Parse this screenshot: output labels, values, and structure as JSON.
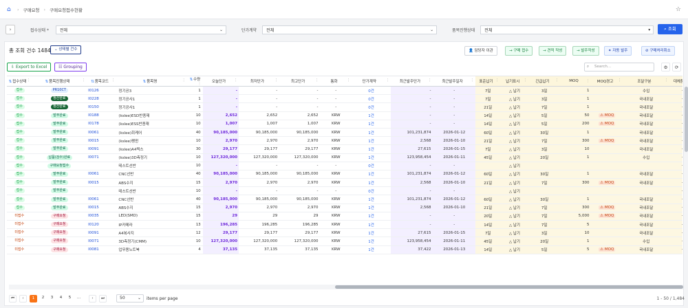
{
  "breadcrumb": [
    "구매요청",
    "구매요청접수현황"
  ],
  "filters": {
    "status_label": "접수상태 *",
    "status_value": "전체",
    "contract_label": "단가계약",
    "contract_value": "전체",
    "progress_label": "품목진행상태",
    "progress_value": "전체",
    "search_label": "조회"
  },
  "summary": {
    "text": "총 조회 건수  1484 건",
    "detail_btn": "상태별 건수"
  },
  "toolbar": {
    "transfer": "담당자 이관",
    "receive": "구매 접수",
    "estimate": "견적 작성",
    "order": "발주작성",
    "auto_order": "자동 발주",
    "cancel": "구매처리취소"
  },
  "actions": {
    "export": "Export to Excel",
    "grouping": "Grouping",
    "search_placeholder": "Search..."
  },
  "columns": [
    "접수상태",
    "품목진행상태",
    "품목코드",
    "품목명",
    "수량",
    "오늘단가",
    "최저단가",
    "최고단가",
    "통화",
    "단가계약",
    "최근발주단가",
    "최근발주일자",
    "표준납기",
    "납기표시",
    "긴급납기",
    "MOQ",
    "MOQ경고",
    "조달구분",
    "대체품목"
  ],
  "rows": [
    [
      "접수",
      "PR10CT",
      "I0126",
      "정기공3",
      "1",
      "-",
      "-",
      "-",
      "-",
      "0건",
      "-",
      "-",
      "7일",
      "△ 납기",
      "3일",
      "1",
      "",
      "수입",
      "-"
    ],
    [
      "접수",
      "정산완료",
      "I0228",
      "정기공사1",
      "1",
      "-",
      "-",
      "-",
      "-",
      "0건",
      "-",
      "-",
      "7일",
      "△ 납기",
      "3일",
      "1",
      "",
      "국내조달",
      "-"
    ],
    [
      "접수",
      "정산완료",
      "I0150",
      "정기공사1",
      "1",
      "-",
      "-",
      "-",
      "-",
      "0건",
      "-",
      "-",
      "21일",
      "△ 납기",
      "7일",
      "1",
      "",
      "국내조달",
      "-"
    ],
    [
      "접수",
      "발주완료",
      "I0188",
      "(kslee)ESD반종재",
      "10",
      "2,652",
      "2,652",
      "2,652",
      "KRW",
      "1건",
      "-",
      "-",
      "14일",
      "△ 납기",
      "5일",
      "50",
      "⚠ MOQ",
      "국내조달",
      "-"
    ],
    [
      "접수",
      "발주완료",
      "I0178",
      "(kslee)ESS반종재",
      "10",
      "1,007",
      "1,007",
      "1,007",
      "KRW",
      "1건",
      "-",
      "-",
      "14일",
      "△ 납기",
      "5일",
      "200",
      "⚠ MOQ",
      "국내조달",
      "-"
    ],
    [
      "접수",
      "발주완료",
      "I0061",
      "(kslee)회케어",
      "40",
      "90,185,000",
      "90,185,000",
      "90,185,000",
      "KRW",
      "1건",
      "101,231,874",
      "2026-01-12",
      "60일",
      "△ 납기",
      "30일",
      "1",
      "",
      "국내조달",
      "-"
    ],
    [
      "접수",
      "발주완료",
      "I0015",
      "(kslee)펭윈",
      "10",
      "2,970",
      "2,970",
      "2,970",
      "KRW",
      "1건",
      "2,568",
      "2026-01-10",
      "21일",
      "△ 납기",
      "7일",
      "300",
      "⚠ MOQ",
      "국내조달",
      "-"
    ],
    [
      "접수",
      "발주완료",
      "I0091",
      "(kslee)A4찍스",
      "30",
      "29,177",
      "29,177",
      "29,177",
      "KRW",
      "1건",
      "27,615",
      "2026-01-15",
      "7일",
      "△ 납기",
      "3일",
      "10",
      "",
      "국내조달",
      "-"
    ],
    [
      "접수",
      "납품(검수)완료",
      "I0071",
      "(kslee)3D측정기",
      "10",
      "127,320,000",
      "127,320,000",
      "127,320,000",
      "KRW",
      "1건",
      "123,958,454",
      "2026-01-11",
      "45일",
      "△ 납기",
      "20일",
      "1",
      "",
      "수입",
      "-"
    ],
    [
      "접수",
      "구매요청접수",
      "",
      "테스트선반",
      "10",
      "-",
      "-",
      "-",
      "-",
      "0건",
      "-",
      "-",
      "",
      "△ 납기",
      "",
      "",
      "",
      "",
      "-"
    ],
    [
      "접수",
      "발주완료",
      "I0061",
      "CNC선반",
      "40",
      "90,185,000",
      "90,185,000",
      "90,185,000",
      "KRW",
      "1건",
      "101,231,874",
      "2026-01-12",
      "60일",
      "△ 납기",
      "30일",
      "1",
      "",
      "국내조달",
      "-"
    ],
    [
      "접수",
      "발주완료",
      "I0015",
      "ABS수지",
      "15",
      "2,970",
      "2,970",
      "2,970",
      "KRW",
      "1건",
      "2,568",
      "2026-01-10",
      "21일",
      "△ 납기",
      "7일",
      "300",
      "⚠ MOQ",
      "국내조달",
      "-"
    ],
    [
      "접수",
      "발주완료",
      "",
      "테스트선반",
      "10",
      "-",
      "-",
      "-",
      "-",
      "0건",
      "-",
      "-",
      "",
      "△ 납기",
      "",
      "",
      "",
      "",
      "-"
    ],
    [
      "접수",
      "발주완료",
      "I0061",
      "CNC선반",
      "40",
      "90,185,000",
      "90,185,000",
      "90,185,000",
      "KRW",
      "1건",
      "101,231,874",
      "2026-01-12",
      "60일",
      "△ 납기",
      "30일",
      "1",
      "",
      "국내조달",
      "-"
    ],
    [
      "접수",
      "발주완료",
      "I0015",
      "ABS수지",
      "15",
      "2,970",
      "2,970",
      "2,970",
      "KRW",
      "1건",
      "2,568",
      "2026-01-10",
      "21일",
      "△ 납기",
      "7일",
      "300",
      "⚠ MOQ",
      "국내조달",
      "-"
    ],
    [
      "미접수",
      "구매요청",
      "I0035",
      "LED(SMD)",
      "15",
      "29",
      "29",
      "29",
      "KRW",
      "1건",
      "-",
      "-",
      "20일",
      "△ 납기",
      "7일",
      "5,000",
      "⚠ MOQ",
      "국내조달",
      "-"
    ],
    [
      "미접수",
      "구매요청",
      "I0120",
      "IP카메라",
      "13",
      "196,285",
      "196,285",
      "196,285",
      "KRW",
      "1건",
      "-",
      "-",
      "14일",
      "△ 납기",
      "7일",
      "5",
      "",
      "국내조달",
      "-"
    ],
    [
      "미접수",
      "구매요청",
      "I0091",
      "A4복사지",
      "12",
      "29,177",
      "29,177",
      "29,177",
      "KRW",
      "1건",
      "27,615",
      "2026-01-15",
      "7일",
      "△ 납기",
      "3일",
      "10",
      "",
      "국내조달",
      "-"
    ],
    [
      "미접수",
      "구매요청",
      "I0071",
      "3D측정기(CMM)",
      "10",
      "127,320,000",
      "127,320,000",
      "127,320,000",
      "KRW",
      "1건",
      "123,958,454",
      "2026-01-11",
      "45일",
      "△ 납기",
      "20일",
      "1",
      "",
      "수입",
      "-"
    ],
    [
      "미접수",
      "구매요청",
      "I0081",
      "업무용노트북",
      "4",
      "37,135",
      "37,135",
      "37,135",
      "KRW",
      "1건",
      "37,422",
      "2026-01-13",
      "14일",
      "△ 납기",
      "5일",
      "5",
      "⚠ MOQ",
      "국내조달",
      "-"
    ]
  ],
  "pagination": {
    "pages": [
      "1",
      "2",
      "3",
      "4",
      "5",
      "..."
    ],
    "per_page": "50",
    "per_page_label": "items per page",
    "info": "1 - 50 / 1,484"
  },
  "colors": {
    "accent": "#2563eb",
    "active_page": "#f97316"
  }
}
